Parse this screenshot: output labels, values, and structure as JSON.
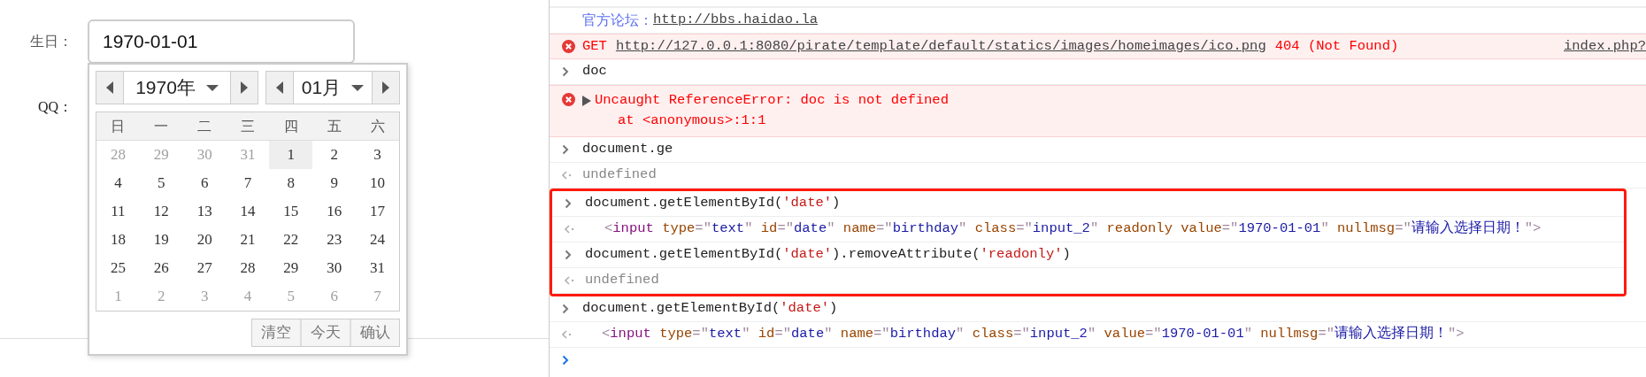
{
  "form": {
    "labels": [
      {
        "text": "生日："
      },
      {
        "text": "QQ："
      }
    ],
    "birthday": {
      "value": "1970-01-01"
    }
  },
  "calendar": {
    "year": "1970年",
    "month": "01月",
    "weekdays": [
      "日",
      "一",
      "二",
      "三",
      "四",
      "五",
      "六"
    ],
    "days": [
      {
        "text": "28",
        "in_month": false,
        "selected": false
      },
      {
        "text": "29",
        "in_month": false,
        "selected": false
      },
      {
        "text": "30",
        "in_month": false,
        "selected": false
      },
      {
        "text": "31",
        "in_month": false,
        "selected": false
      },
      {
        "text": "1",
        "in_month": true,
        "selected": true
      },
      {
        "text": "2",
        "in_month": true,
        "selected": false
      },
      {
        "text": "3",
        "in_month": true,
        "selected": false
      },
      {
        "text": "4",
        "in_month": true,
        "selected": false
      },
      {
        "text": "5",
        "in_month": true,
        "selected": false
      },
      {
        "text": "6",
        "in_month": true,
        "selected": false
      },
      {
        "text": "7",
        "in_month": true,
        "selected": false
      },
      {
        "text": "8",
        "in_month": true,
        "selected": false
      },
      {
        "text": "9",
        "in_month": true,
        "selected": false
      },
      {
        "text": "10",
        "in_month": true,
        "selected": false
      },
      {
        "text": "11",
        "in_month": true,
        "selected": false
      },
      {
        "text": "12",
        "in_month": true,
        "selected": false
      },
      {
        "text": "13",
        "in_month": true,
        "selected": false
      },
      {
        "text": "14",
        "in_month": true,
        "selected": false
      },
      {
        "text": "15",
        "in_month": true,
        "selected": false
      },
      {
        "text": "16",
        "in_month": true,
        "selected": false
      },
      {
        "text": "17",
        "in_month": true,
        "selected": false
      },
      {
        "text": "18",
        "in_month": true,
        "selected": false
      },
      {
        "text": "19",
        "in_month": true,
        "selected": false
      },
      {
        "text": "20",
        "in_month": true,
        "selected": false
      },
      {
        "text": "21",
        "in_month": true,
        "selected": false
      },
      {
        "text": "22",
        "in_month": true,
        "selected": false
      },
      {
        "text": "23",
        "in_month": true,
        "selected": false
      },
      {
        "text": "24",
        "in_month": true,
        "selected": false
      },
      {
        "text": "25",
        "in_month": true,
        "selected": false
      },
      {
        "text": "26",
        "in_month": true,
        "selected": false
      },
      {
        "text": "27",
        "in_month": true,
        "selected": false
      },
      {
        "text": "28",
        "in_month": true,
        "selected": false
      },
      {
        "text": "29",
        "in_month": true,
        "selected": false
      },
      {
        "text": "30",
        "in_month": true,
        "selected": false
      },
      {
        "text": "31",
        "in_month": true,
        "selected": false
      },
      {
        "text": "1",
        "in_month": false,
        "selected": false
      },
      {
        "text": "2",
        "in_month": false,
        "selected": false
      },
      {
        "text": "3",
        "in_month": false,
        "selected": false
      },
      {
        "text": "4",
        "in_month": false,
        "selected": false
      },
      {
        "text": "5",
        "in_month": false,
        "selected": false
      },
      {
        "text": "6",
        "in_month": false,
        "selected": false
      },
      {
        "text": "7",
        "in_month": false,
        "selected": false
      }
    ],
    "buttons": [
      "清空",
      "今天",
      "确认"
    ]
  },
  "console": {
    "sections": [
      {
        "highlighted": false,
        "rows": [
          {
            "kind": "log",
            "label": "官方论坛：",
            "link": "http://bbs.haidao.la"
          },
          {
            "kind": "network_error",
            "method": "GET",
            "url": "http://127.0.0.1:8080/pirate/template/default/statics/images/homeimages/ico.png",
            "status": "404 (Not Found)",
            "source": "index.php?"
          },
          {
            "kind": "input",
            "tokens": [
              {
                "kind": "code",
                "text": "doc"
              }
            ]
          },
          {
            "kind": "error",
            "lines": [
              "Uncaught ReferenceError: doc is not defined",
              "at <anonymous>:1:1"
            ]
          },
          {
            "kind": "input",
            "tokens": [
              {
                "kind": "code",
                "text": "document.ge"
              }
            ]
          },
          {
            "kind": "result",
            "text": "undefined"
          }
        ]
      },
      {
        "highlighted": true,
        "rows": [
          {
            "kind": "input",
            "tokens": [
              {
                "kind": "code",
                "text": "document.getElementById("
              },
              {
                "kind": "string",
                "text": "'date'"
              },
              {
                "kind": "code",
                "text": ")"
              }
            ]
          },
          {
            "kind": "element",
            "tokens": [
              {
                "kind": "bracket",
                "text": "<"
              },
              {
                "kind": "tag",
                "text": "input"
              },
              {
                "kind": "attr",
                "text": " type"
              },
              {
                "kind": "bracket",
                "text": "=\""
              },
              {
                "kind": "value",
                "text": "text"
              },
              {
                "kind": "bracket",
                "text": "\""
              },
              {
                "kind": "attr",
                "text": " id"
              },
              {
                "kind": "bracket",
                "text": "=\""
              },
              {
                "kind": "value",
                "text": "date"
              },
              {
                "kind": "bracket",
                "text": "\""
              },
              {
                "kind": "attr",
                "text": " name"
              },
              {
                "kind": "bracket",
                "text": "=\""
              },
              {
                "kind": "value",
                "text": "birthday"
              },
              {
                "kind": "bracket",
                "text": "\""
              },
              {
                "kind": "attr",
                "text": " class"
              },
              {
                "kind": "bracket",
                "text": "=\""
              },
              {
                "kind": "value",
                "text": "input_2"
              },
              {
                "kind": "bracket",
                "text": "\""
              },
              {
                "kind": "attr",
                "text": " readonly value"
              },
              {
                "kind": "bracket",
                "text": "=\""
              },
              {
                "kind": "value",
                "text": "1970-01-01"
              },
              {
                "kind": "bracket",
                "text": "\""
              },
              {
                "kind": "attr",
                "text": " nullmsg"
              },
              {
                "kind": "bracket",
                "text": "=\""
              },
              {
                "kind": "value",
                "text": "请输入选择日期！"
              },
              {
                "kind": "bracket",
                "text": "\">"
              }
            ]
          },
          {
            "kind": "input",
            "tokens": [
              {
                "kind": "code",
                "text": "document.getElementById("
              },
              {
                "kind": "string",
                "text": "'date'"
              },
              {
                "kind": "code",
                "text": ").removeAttribute("
              },
              {
                "kind": "string",
                "text": "'readonly'"
              },
              {
                "kind": "code",
                "text": ")"
              }
            ]
          },
          {
            "kind": "result",
            "text": "undefined"
          }
        ]
      },
      {
        "highlighted": false,
        "rows": [
          {
            "kind": "input",
            "tokens": [
              {
                "kind": "code",
                "text": "document.getElementById("
              },
              {
                "kind": "string",
                "text": "'date'"
              },
              {
                "kind": "code",
                "text": ")"
              }
            ]
          },
          {
            "kind": "element",
            "tokens": [
              {
                "kind": "bracket",
                "text": "<"
              },
              {
                "kind": "tag",
                "text": "input"
              },
              {
                "kind": "attr",
                "text": " type"
              },
              {
                "kind": "bracket",
                "text": "=\""
              },
              {
                "kind": "value",
                "text": "text"
              },
              {
                "kind": "bracket",
                "text": "\""
              },
              {
                "kind": "attr",
                "text": " id"
              },
              {
                "kind": "bracket",
                "text": "=\""
              },
              {
                "kind": "value",
                "text": "date"
              },
              {
                "kind": "bracket",
                "text": "\""
              },
              {
                "kind": "attr",
                "text": " name"
              },
              {
                "kind": "bracket",
                "text": "=\""
              },
              {
                "kind": "value",
                "text": "birthday"
              },
              {
                "kind": "bracket",
                "text": "\""
              },
              {
                "kind": "attr",
                "text": " class"
              },
              {
                "kind": "bracket",
                "text": "=\""
              },
              {
                "kind": "value",
                "text": "input_2"
              },
              {
                "kind": "bracket",
                "text": "\""
              },
              {
                "kind": "attr",
                "text": " value"
              },
              {
                "kind": "bracket",
                "text": "=\""
              },
              {
                "kind": "value",
                "text": "1970-01-01"
              },
              {
                "kind": "bracket",
                "text": "\""
              },
              {
                "kind": "attr",
                "text": " nullmsg"
              },
              {
                "kind": "bracket",
                "text": "=\""
              },
              {
                "kind": "value",
                "text": "请输入选择日期！"
              },
              {
                "kind": "bracket",
                "text": "\">"
              }
            ]
          },
          {
            "kind": "prompt"
          }
        ]
      }
    ]
  }
}
